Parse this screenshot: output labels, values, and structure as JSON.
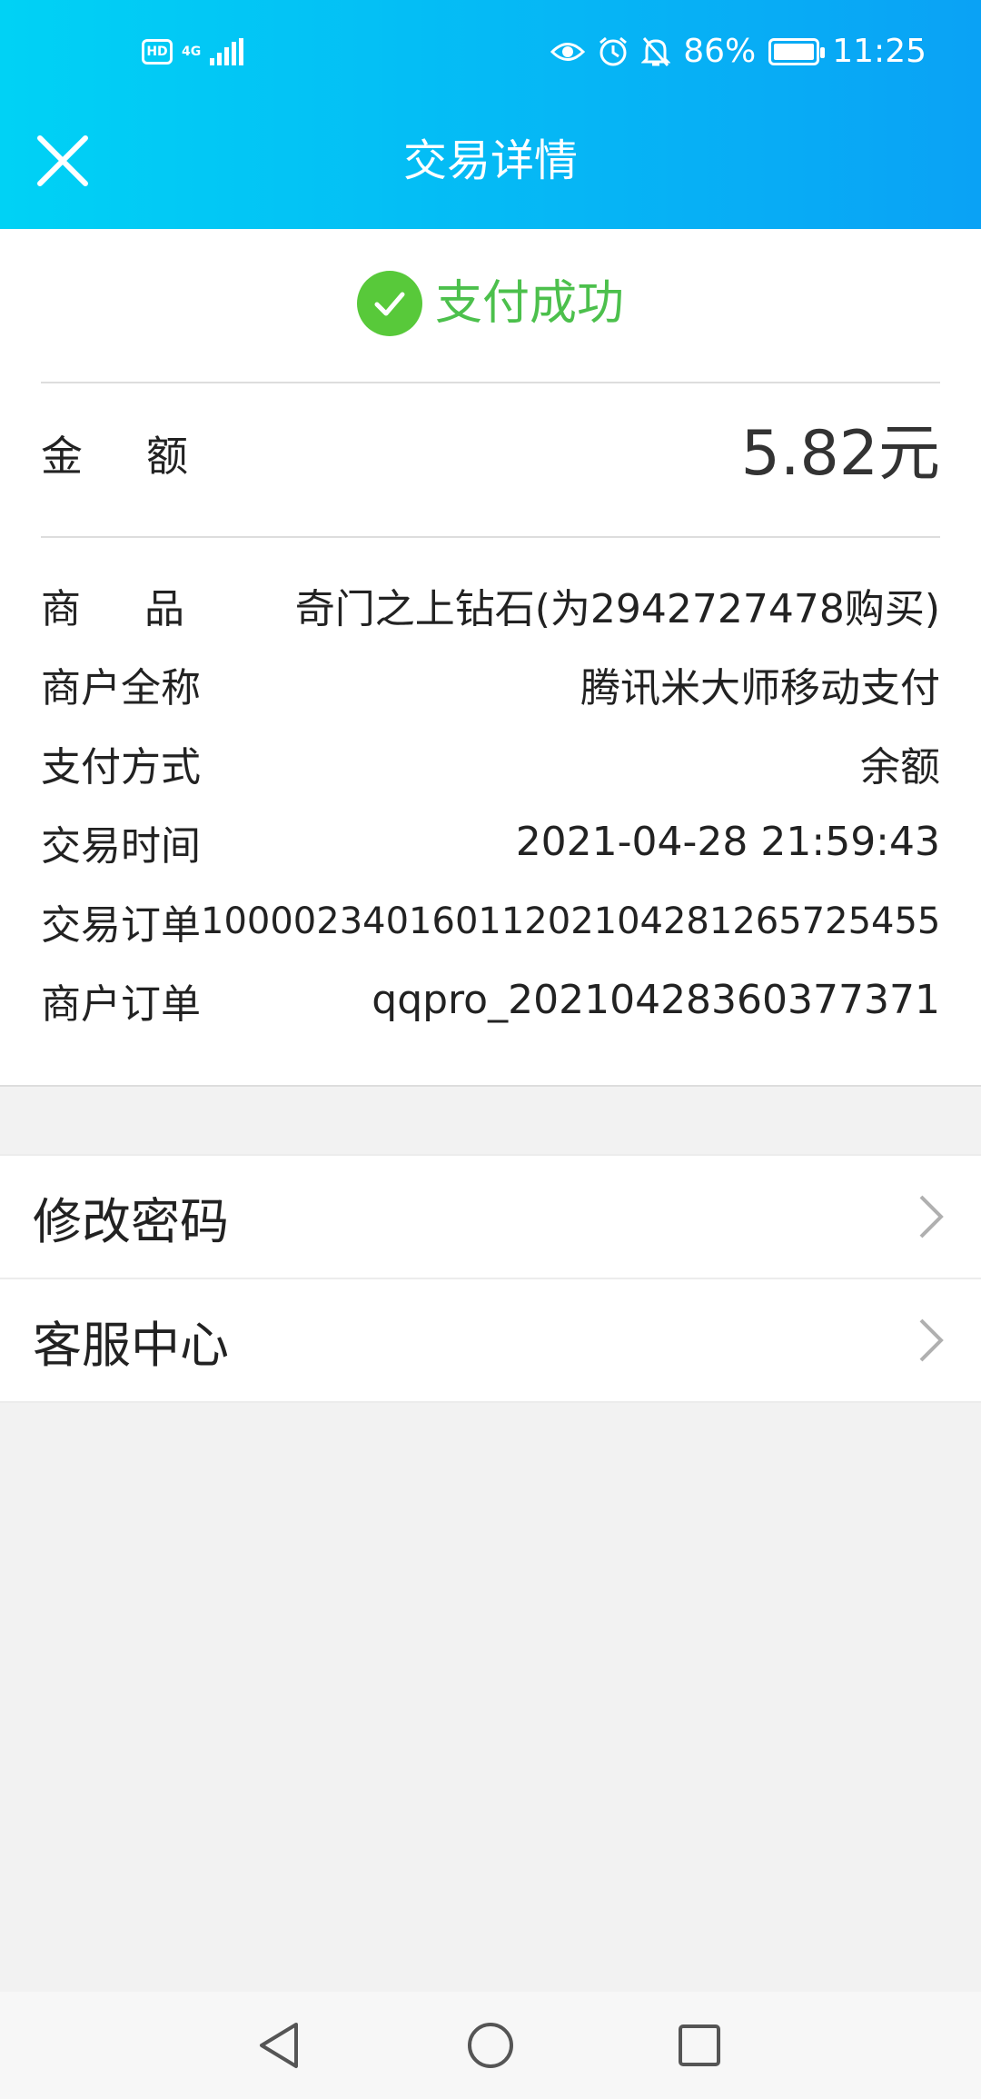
{
  "status_bar": {
    "hd": "HD",
    "network": "4G",
    "battery_percent": "86%",
    "battery_level": 0.86,
    "time": "11:25",
    "icons": [
      "eye-icon",
      "alarm-icon",
      "bell-off-icon",
      "battery-icon"
    ]
  },
  "header": {
    "title": "交易详情",
    "close_icon": "close-icon"
  },
  "status": {
    "text": "支付成功",
    "color": "#4cc04c"
  },
  "amount": {
    "label": "金额",
    "value": "5.82元"
  },
  "details": [
    {
      "label": "商品",
      "value": "奇门之上钻石(为2942727478购买)"
    },
    {
      "label": "商户全称",
      "value": "腾讯米大师移动支付"
    },
    {
      "label": "支付方式",
      "value": "余额"
    },
    {
      "label": "交易时间",
      "value": "2021-04-28 21:59:43"
    },
    {
      "label": "交易订单",
      "value": "10000234016011202104281265725455"
    },
    {
      "label": "商户订单",
      "value": "qqpro_20210428360377371"
    }
  ],
  "menu": [
    {
      "label": "修改密码"
    },
    {
      "label": "客服中心"
    }
  ],
  "colors": {
    "header_start": "#00d2f5",
    "header_end": "#0aa2f5",
    "success_green": "#58c93a"
  }
}
